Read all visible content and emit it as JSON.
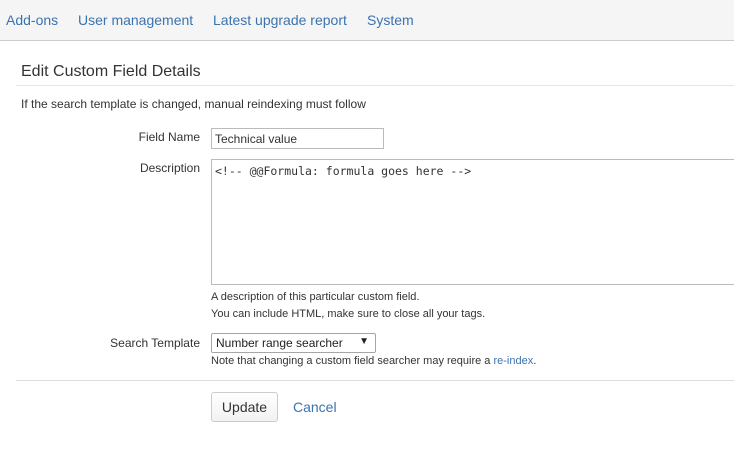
{
  "topnav": {
    "items": [
      {
        "label": "Add-ons"
      },
      {
        "label": "User management"
      },
      {
        "label": "Latest upgrade report"
      },
      {
        "label": "System"
      }
    ]
  },
  "form": {
    "title": "Edit Custom Field Details",
    "info": "If the search template is changed, manual reindexing must follow",
    "field_name": {
      "label": "Field Name",
      "value": "Technical value"
    },
    "description": {
      "label": "Description",
      "value": "<!-- @@Formula: formula goes here -->",
      "help_line1": "A description of this particular custom field.",
      "help_line2": "You can include HTML, make sure to close all your tags."
    },
    "search_template": {
      "label": "Search Template",
      "selected": "Number range searcher",
      "note_prefix": "Note that changing a custom field searcher may require a ",
      "note_link": "re-index",
      "note_suffix": "."
    },
    "update_label": "Update",
    "cancel_label": "Cancel"
  },
  "colors": {
    "link": "#3b73af",
    "nav_background": "#f5f5f5",
    "text": "#333333"
  }
}
